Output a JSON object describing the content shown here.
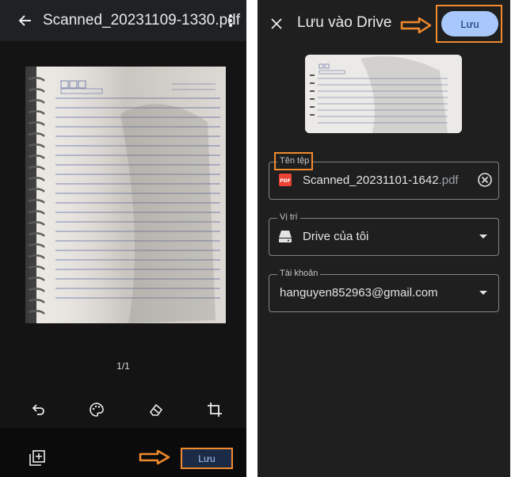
{
  "left": {
    "title": "Scanned_20231109-1330.pdf",
    "page_counter": "1/1",
    "save_label": "Lưu",
    "tools": [
      "undo-icon",
      "palette-icon",
      "eraser-icon",
      "crop-icon"
    ],
    "notebook_header": {
      "memo": "Memo No.",
      "date": "Date",
      "days": "Mo Tu We Th Fr Sa Su"
    },
    "notebook_brand": "HẢI TIẾN"
  },
  "right": {
    "title": "Lưu vào Drive",
    "save_label": "Lưu",
    "file_name_label": "Tên tệp",
    "file_name": "Scanned_20231101-1642",
    "file_ext": ".pdf",
    "location_label": "Vị trí",
    "location_value": "Drive của tôi",
    "account_label": "Tài khoản",
    "account_value": "hanguyen852963@gmail.com",
    "pdf_badge": "PDF"
  },
  "colors": {
    "highlight": "#f08a2c",
    "accent": "#a8c7fa",
    "background": "#202124"
  }
}
